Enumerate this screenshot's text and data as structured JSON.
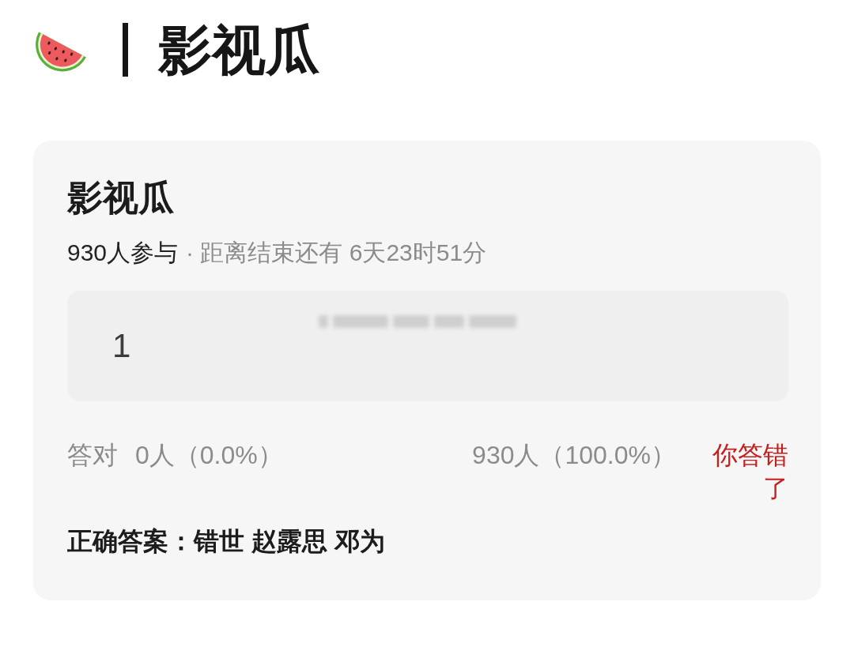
{
  "header": {
    "title": "影视瓜"
  },
  "card": {
    "title": "影视瓜",
    "participants": "930人参与",
    "deadline": "· 距离结束还有 6天23时51分",
    "option": {
      "number": "1"
    },
    "stats": {
      "label": "答对",
      "correct_count": "0人（0.0%）",
      "wrong_count": "930人（100.0%）",
      "result": {
        "text": "你答错了",
        "correct": false
      }
    },
    "answer": "正确答案：错世 赵露思 邓为"
  }
}
